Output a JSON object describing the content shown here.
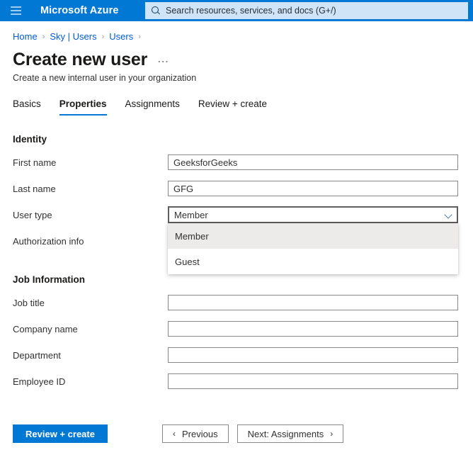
{
  "topbar": {
    "menu_icon": "hamburger-menu-icon",
    "brand": "Microsoft Azure",
    "search": {
      "icon": "search-icon",
      "placeholder": "Search resources, services, and docs (G+/)",
      "value": ""
    }
  },
  "breadcrumb": {
    "items": [
      "Home",
      "Sky | Users",
      "Users"
    ],
    "separator": "›",
    "trailing_separator": "›"
  },
  "header": {
    "title": "Create new user",
    "more_label": "⋯",
    "subtitle": "Create a new internal user in your organization"
  },
  "tabs": [
    {
      "label": "Basics",
      "active": false
    },
    {
      "label": "Properties",
      "active": true
    },
    {
      "label": "Assignments",
      "active": false
    },
    {
      "label": "Review + create",
      "active": false
    }
  ],
  "form": {
    "identity": {
      "heading": "Identity",
      "fields": [
        {
          "label": "First name",
          "value": "GeeksforGeeks",
          "placeholder": ""
        },
        {
          "label": "Last name",
          "value": "GFG",
          "placeholder": ""
        }
      ],
      "user_type": {
        "label": "User type",
        "value": "Member",
        "chevron_icon": "chevron-down-icon",
        "options": [
          "Member",
          "Guest"
        ],
        "expanded": true
      },
      "authorization_info": {
        "label": "Authorization info"
      }
    },
    "job_information": {
      "heading": "Job Information",
      "fields": [
        {
          "label": "Job title",
          "value": "",
          "placeholder": ""
        },
        {
          "label": "Company name",
          "value": "",
          "placeholder": ""
        },
        {
          "label": "Department",
          "value": "",
          "placeholder": ""
        },
        {
          "label": "Employee ID",
          "value": "",
          "placeholder": ""
        }
      ]
    }
  },
  "footer": {
    "review_create": "Review + create",
    "previous": "Previous",
    "previous_arrow": "‹",
    "next": "Next: Assignments",
    "next_arrow": "›"
  },
  "colors": {
    "azure_blue": "#0078d4",
    "search_bg": "#cfe4f7",
    "link_blue": "#015cda",
    "selected_option": "#edebe9",
    "field_border": "#8a8886",
    "focus_border": "#605e5c"
  }
}
